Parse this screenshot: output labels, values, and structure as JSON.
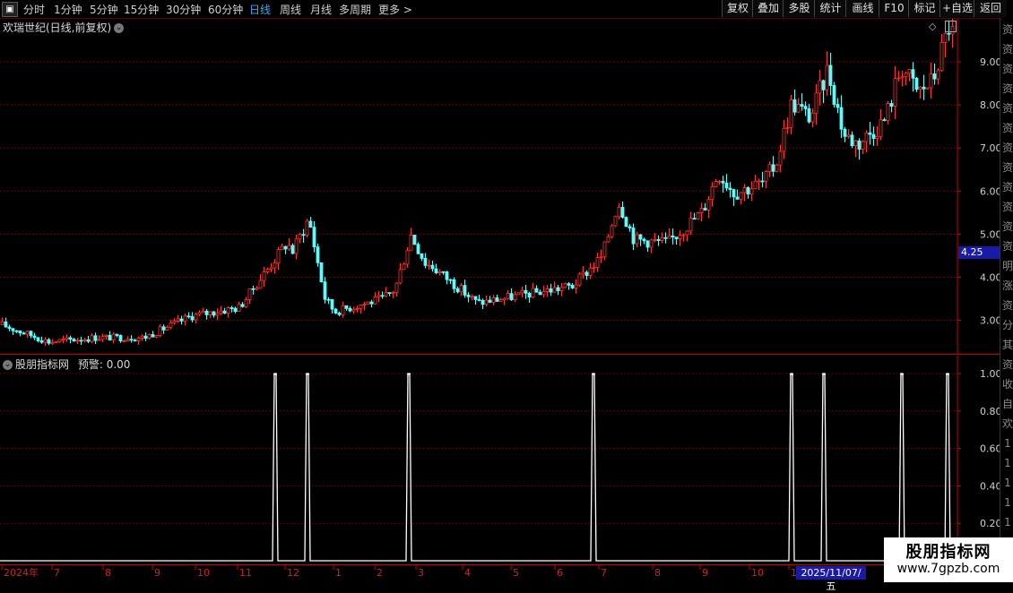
{
  "toolbar": {
    "periods": [
      "分时",
      "1分钟",
      "5分钟",
      "15分钟",
      "30分钟",
      "60分钟",
      "日线",
      "周线",
      "月线",
      "多周期",
      "更多 >"
    ],
    "active_period": "日线",
    "buttons": [
      "复权",
      "叠加",
      "多股",
      "统计",
      "画线",
      "F10",
      "标记",
      "+自选",
      "返回"
    ]
  },
  "main_panel": {
    "title": "欢瑞世纪(日线,前复权)",
    "current_price": "4.25"
  },
  "indicator_panel": {
    "title": "股朋指标网",
    "alert_label": "预警: 0.00"
  },
  "right_strip_glyphs": [
    "资",
    "资",
    "资",
    "资",
    "资",
    "资",
    "资",
    "资",
    "资",
    "资",
    "资",
    "资",
    "明",
    "涨",
    "资",
    "分",
    "其",
    "资",
    "收",
    "自",
    "欢",
    "1",
    "1",
    "1",
    "1",
    "1"
  ],
  "date_axis": {
    "labels": [
      "2024年",
      "7",
      "8",
      "9",
      "10",
      "11",
      "12",
      "1",
      "2",
      "3",
      "4",
      "5",
      "6",
      "7",
      "8",
      "9",
      "10",
      "1"
    ],
    "cursor_date": "2025/11/07/五"
  },
  "watermark": {
    "line1": "股朋指标网",
    "line2": "www.7gpzb.com"
  },
  "colors": {
    "up": "#ff3333",
    "down": "#54ffff",
    "grid": "#7a0000",
    "axis": "#cc0000",
    "signal": "#ffffff",
    "price_tag": "#1a1aa8"
  },
  "chart_data": [
    {
      "type": "candlestick",
      "title": "欢瑞世纪(日线,前复权)",
      "y_ticks": [
        3.0,
        4.0,
        5.0,
        6.0,
        7.0,
        8.0,
        9.0
      ],
      "ylim": [
        2.2,
        10.0
      ],
      "last_price": 4.25,
      "approx_close_trend": [
        {
          "x": "2024-06",
          "y": 2.9
        },
        {
          "x": "2024-07",
          "y": 2.5
        },
        {
          "x": "2024-08",
          "y": 2.6
        },
        {
          "x": "2024-09",
          "y": 2.6
        },
        {
          "x": "2024-10",
          "y": 3.1
        },
        {
          "x": "2024-11",
          "y": 3.3
        },
        {
          "x": "2024-12",
          "y": 4.8
        },
        {
          "x": "2025-01",
          "y": 3.2
        },
        {
          "x": "2025-02",
          "y": 3.5
        },
        {
          "x": "2025-03",
          "y": 4.3
        },
        {
          "x": "2025-04",
          "y": 3.4
        },
        {
          "x": "2025-05",
          "y": 3.6
        },
        {
          "x": "2025-06",
          "y": 3.8
        },
        {
          "x": "2025-07",
          "y": 4.9
        },
        {
          "x": "2025-08",
          "y": 4.8
        },
        {
          "x": "2025-09",
          "y": 5.8
        },
        {
          "x": "2025-10",
          "y": 6.2
        },
        {
          "x": "2025-11",
          "y": 7.8
        },
        {
          "x": "2025-12",
          "y": 7.1
        },
        {
          "x": "2026-01",
          "y": 8.1
        },
        {
          "x": "2026-02",
          "y": 8.9
        }
      ]
    },
    {
      "type": "line",
      "title": "股朋指标网",
      "y_ticks": [
        0.2,
        0.4,
        0.6,
        0.8,
        1.0
      ],
      "ylim": [
        0,
        1.0
      ],
      "signal_dates": [
        "2024-12",
        "2024-12",
        "2025-03",
        "2025-07",
        "2025-11",
        "2025-11",
        "2026-01",
        "2026-02"
      ],
      "signal_value": 1.0,
      "baseline_value": 0.0
    }
  ]
}
